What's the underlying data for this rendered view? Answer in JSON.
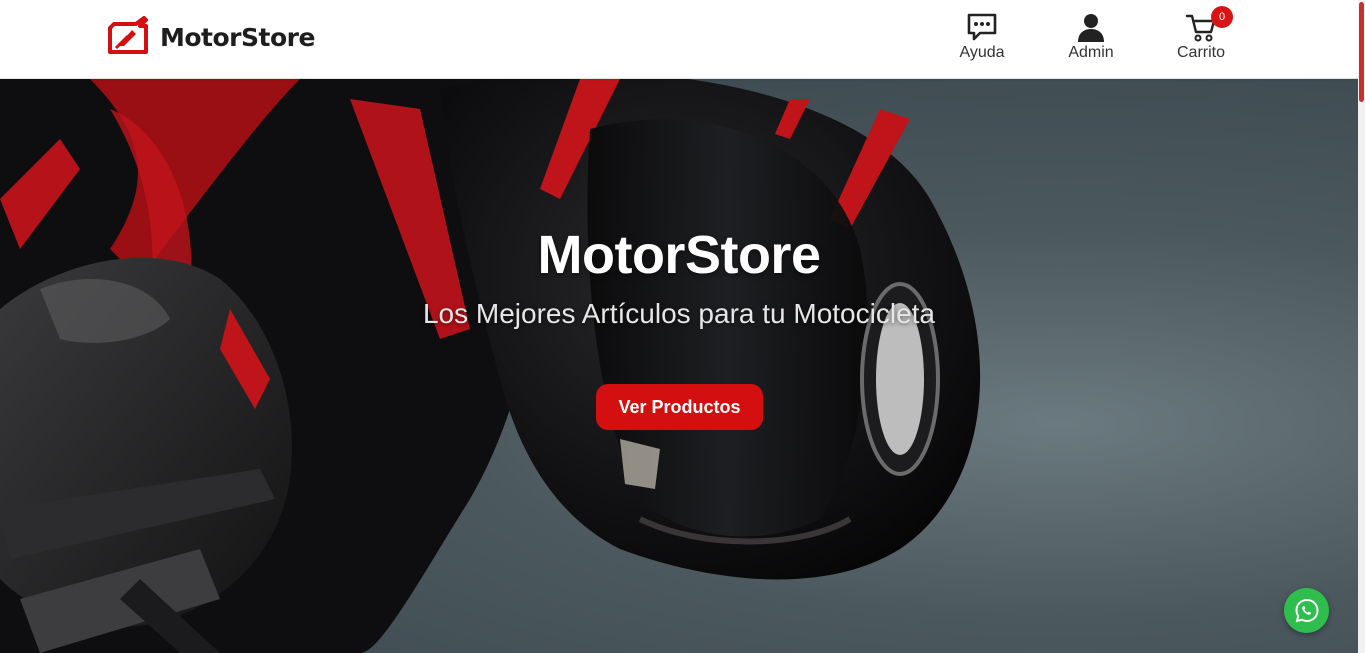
{
  "header": {
    "logo_text": "MotorStore",
    "nav": {
      "help_label": "Ayuda",
      "admin_label": "Admin",
      "cart_label": "Carrito",
      "cart_count": "0"
    }
  },
  "hero": {
    "title": "MotorStore",
    "subtitle": "Los Mejores Artículos para tu Motocicleta",
    "button_label": "Ver Productos",
    "background_description_icon": "motorcycle-rider-helmet-photo"
  },
  "floating": {
    "whatsapp_icon": "whatsapp-icon"
  },
  "colors": {
    "brand_red": "#d30f0f",
    "badge_red": "#d81414",
    "whatsapp_green": "#2fbe4d",
    "header_bg": "#ffffff"
  }
}
